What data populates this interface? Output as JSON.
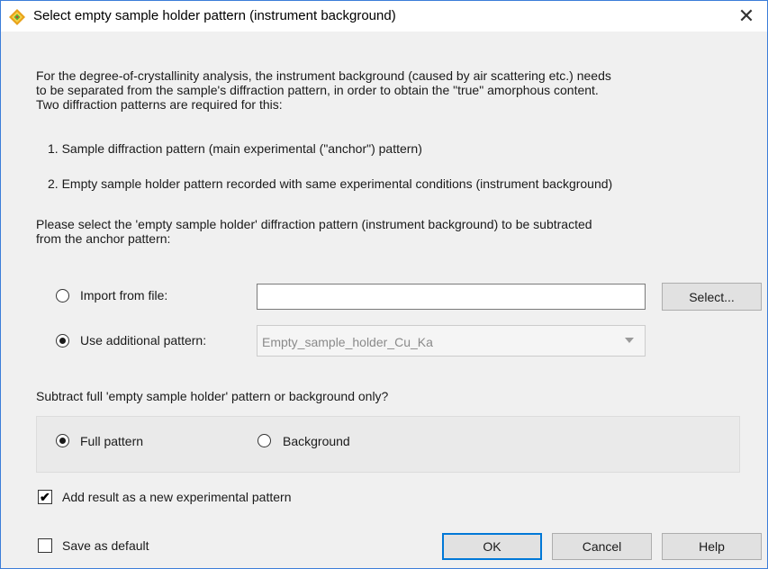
{
  "dialog": {
    "title": "Select empty sample holder pattern (instrument background)",
    "close_symbol": "✕"
  },
  "intro": {
    "lines": [
      "For the degree-of-crystallinity analysis, the instrument background (caused by air scattering etc.) needs",
      "to be separated from the sample's diffraction pattern, in order to obtain the \"true\" amorphous content.",
      "Two diffraction patterns are required for this:"
    ]
  },
  "list": {
    "item1": "1. Sample diffraction pattern (main experimental (\"anchor\") pattern)",
    "item2": "2. Empty sample holder pattern recorded with same experimental conditions (instrument background)"
  },
  "prompt": {
    "lines": [
      "Please select the 'empty sample holder' diffraction pattern (instrument background) to be subtracted",
      "from the anchor pattern:"
    ]
  },
  "source": {
    "import_label": "Import from file:",
    "import_selected": false,
    "file_path": "",
    "select_button": "Select...",
    "additional_label": "Use additional pattern:",
    "additional_selected": true,
    "additional_value": "Empty_sample_holder_Cu_Ka"
  },
  "subtract": {
    "question": "Subtract full 'empty sample holder' pattern or background only?",
    "full_label": "Full pattern",
    "full_selected": true,
    "background_label": "Background",
    "background_selected": false
  },
  "options": {
    "add_result_label": "Add result as a new experimental pattern",
    "add_result_checked": true,
    "save_default_label": "Save as default",
    "save_default_checked": false
  },
  "buttons": {
    "ok": "OK",
    "cancel": "Cancel",
    "help": "Help"
  },
  "icons": {
    "app": "diamond-app-icon",
    "close": "close-icon",
    "dropdown": "chevron-down-icon",
    "check": "checkmark-icon"
  },
  "colors": {
    "dialog_border": "#3c7dd9",
    "background": "#f0f0f0",
    "default_button_border": "#0078d7",
    "app_icon_outer": "#e8a21a",
    "app_icon_inner": "#55b83a"
  }
}
